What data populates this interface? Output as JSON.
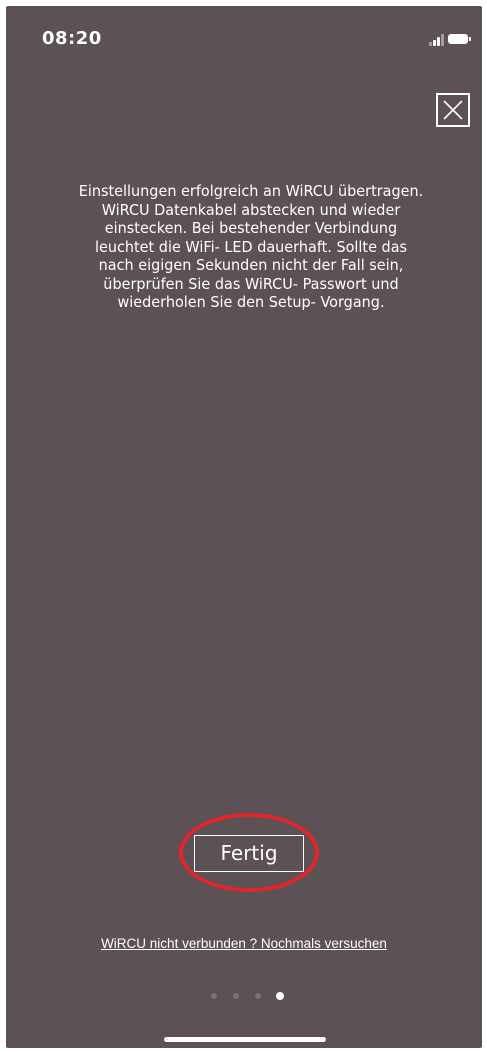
{
  "status_bar": {
    "time": "08:20",
    "signal_icon": "cellular-signal-icon",
    "battery_icon": "battery-icon"
  },
  "close_button": {
    "icon": "close-icon"
  },
  "message": {
    "text": "Einstellungen erfolgreich an WiRCU übertragen.\nWiRCU Datenkabel abstecken und wieder\neinstecken. Bei bestehender Verbindung\nleuchtet die WiFi- LED dauerhaft. Sollte das\nnach eigigen Sekunden nicht der Fall sein,\nüberprüfen Sie das WiRCU- Passwort und\nwiederholen Sie den Setup- Vorgang."
  },
  "actions": {
    "done_label": "Fertig",
    "retry_label": "WiRCU nicht verbunden ? Nochmals versuchen"
  },
  "pagination": {
    "total": 4,
    "current": 4
  },
  "colors": {
    "background": "#5c5154",
    "highlight": "#e0262b",
    "text": "#ffffff"
  }
}
